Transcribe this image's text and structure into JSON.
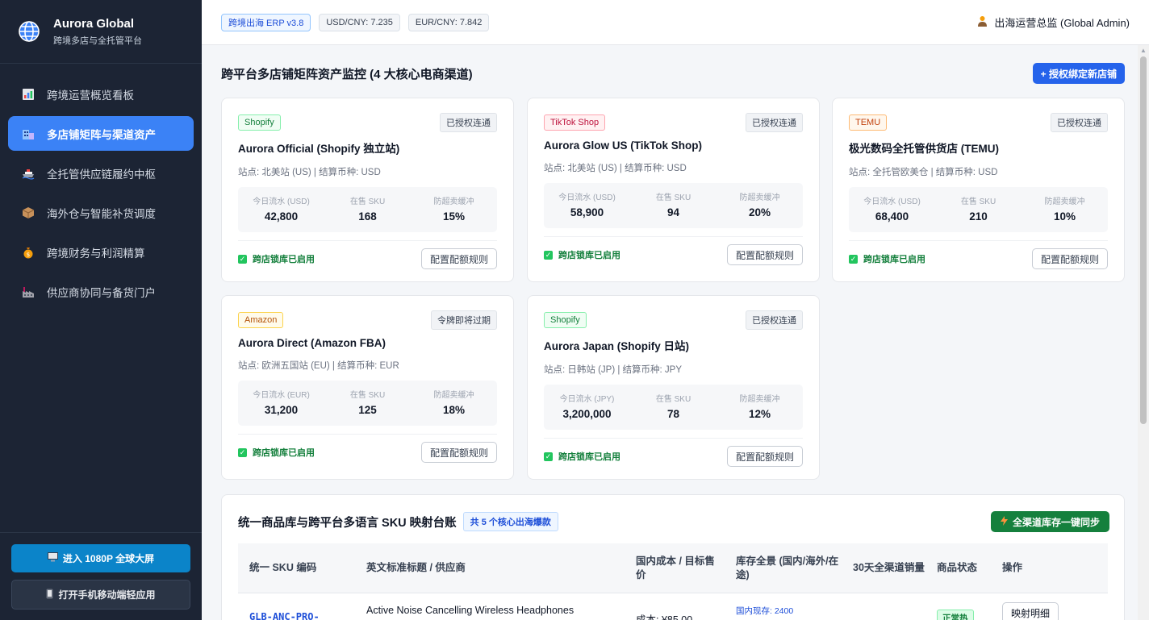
{
  "brand": {
    "title": "Aurora Global",
    "subtitle": "跨境多店与全托管平台"
  },
  "sidebar": {
    "items": [
      {
        "label": "跨境运营概览看板",
        "icon": "bar-chart-icon"
      },
      {
        "label": "多店铺矩阵与渠道资产",
        "icon": "store-icon"
      },
      {
        "label": "全托管供应链履约中枢",
        "icon": "ship-icon"
      },
      {
        "label": "海外仓与智能补货调度",
        "icon": "package-icon"
      },
      {
        "label": "跨境财务与利润精算",
        "icon": "money-bag-icon"
      },
      {
        "label": "供应商协同与备货门户",
        "icon": "factory-icon"
      }
    ],
    "active_index": 1,
    "screen_button": "进入 1080P 全球大屏",
    "mobile_button": "打开手机移动端轻应用"
  },
  "topbar": {
    "erp_version": "跨境出海 ERP v3.8",
    "usd_rate": "USD/CNY: 7.235",
    "eur_rate": "EUR/CNY: 7.842",
    "admin": "出海运营总监 (Global Admin)"
  },
  "stores_section": {
    "title": "跨平台多店铺矩阵资产监控 (4 大核心电商渠道)",
    "add_button": "+ 授权绑定新店铺",
    "metric_labels": {
      "sku": "在售 SKU",
      "buffer": "防超卖缓冲"
    },
    "lock_label": "跨店锁库已启用",
    "config_button": "配置配额规则",
    "stores": [
      {
        "platform": "Shopify",
        "platform_class": "shopify",
        "status": "已授权连通",
        "name": "Aurora Official (Shopify 独立站)",
        "site": "站点: 北美站 (US) | 结算币种: USD",
        "flow_label": "今日流水 (USD)",
        "flow": "42,800",
        "sku": "168",
        "buffer": "15%"
      },
      {
        "platform": "TikTok Shop",
        "platform_class": "tiktok",
        "status": "已授权连通",
        "name": "Aurora Glow US (TikTok Shop)",
        "site": "站点: 北美站 (US) | 结算币种: USD",
        "flow_label": "今日流水 (USD)",
        "flow": "58,900",
        "sku": "94",
        "buffer": "20%"
      },
      {
        "platform": "TEMU",
        "platform_class": "temu",
        "status": "已授权连通",
        "name": "极光数码全托管供货店 (TEMU)",
        "site": "站点: 全托管欧美仓 | 结算币种: USD",
        "flow_label": "今日流水 (USD)",
        "flow": "68,400",
        "sku": "210",
        "buffer": "10%"
      },
      {
        "platform": "Amazon",
        "platform_class": "amazon",
        "status": "令牌即将过期",
        "name": "Aurora Direct (Amazon FBA)",
        "site": "站点: 欧洲五国站 (EU) | 结算币种: EUR",
        "flow_label": "今日流水 (EUR)",
        "flow": "31,200",
        "sku": "125",
        "buffer": "18%"
      },
      {
        "platform": "Shopify",
        "platform_class": "shopify",
        "status": "已授权连通",
        "name": "Aurora Japan (Shopify 日站)",
        "site": "站点: 日韩站 (JP) | 结算币种: JPY",
        "flow_label": "今日流水 (JPY)",
        "flow": "3,200,000",
        "sku": "78",
        "buffer": "12%"
      }
    ]
  },
  "sku_section": {
    "title": "统一商品库与跨平台多语言 SKU 映射台账",
    "count_badge": "共 5 个核心出海爆款",
    "sync_button": "全渠道库存一键同步",
    "columns": [
      "统一 SKU 编码",
      "英文标准标题 / 供应商",
      "国内成本 / 目标售价",
      "库存全景 (国内/海外/在途)",
      "30天全渠道销量",
      "商品状态",
      "操作"
    ],
    "rows": [
      {
        "sku": "GLB-ANC-PRO-",
        "title": "Active Noise Cancelling Wireless Headphones",
        "cost": "成本: ¥85.00",
        "stock": "国内现存: 2400",
        "status": "正常热",
        "action": "映射明细"
      }
    ]
  },
  "colors": {
    "sidebar_bg": "#1c2434",
    "accent": "#3b82f6",
    "primary": "#2563eb",
    "success": "#15803d"
  }
}
